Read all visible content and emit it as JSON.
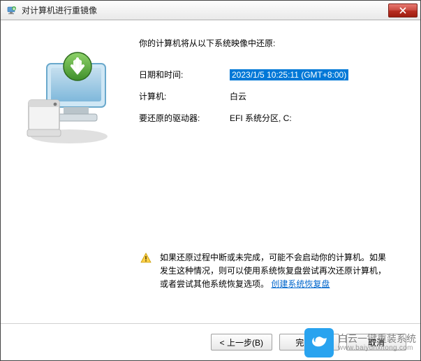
{
  "titlebar": {
    "title": "对计算机进行重镜像"
  },
  "intro": "你的计算机将从以下系统映像中还原:",
  "info": {
    "datetime_label": "日期和时间:",
    "datetime_value": "2023/1/5 10:25:11 (GMT+8:00)",
    "computer_label": "计算机:",
    "computer_value": "白云",
    "drives_label": "要还原的驱动器:",
    "drives_value": "EFI 系统分区, C:"
  },
  "warning": {
    "text_part1": "如果还原过程中断或未完成，可能不会启动你的计算机。如果发生这种情况，则可以使用系统恢复盘尝试再次还原计算机，或者尝试其他系统恢复选项。",
    "link_text": "创建系统恢复盘"
  },
  "buttons": {
    "back": "< 上一步(B)",
    "finish": "完成(F)",
    "cancel": "取消"
  },
  "watermark": {
    "line1": "白云一键重装系统",
    "line2": "www.baiyunxitong.com"
  }
}
